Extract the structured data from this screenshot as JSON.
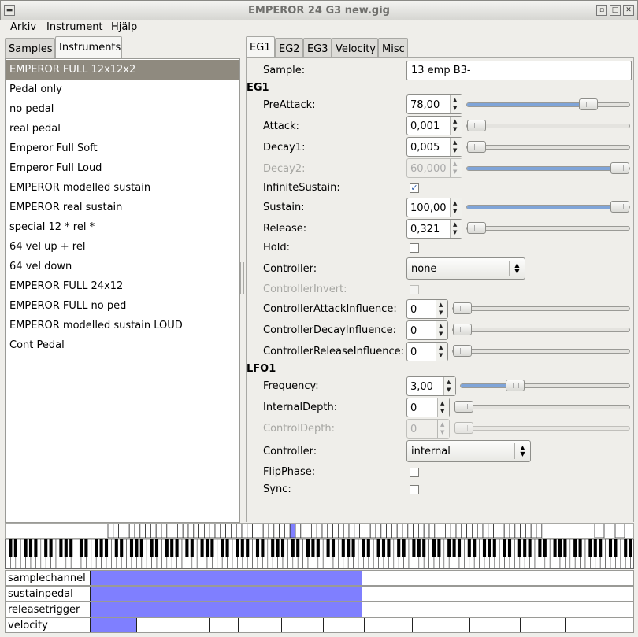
{
  "window": {
    "title": "EMPEROR 24 G3 new.gig"
  },
  "menu": [
    "Arkiv",
    "Instrument",
    "Hjälp"
  ],
  "left_tabs": [
    "Samples",
    "Instruments"
  ],
  "instruments": [
    "EMPEROR FULL 12x12x2",
    "Pedal only",
    "no pedal",
    "real pedal",
    "Emperor Full Soft",
    "Emperor Full Loud",
    "EMPEROR modelled sustain",
    "EMPEROR real sustain",
    "special 12  * rel *",
    "64 vel up + rel",
    "64 vel down",
    "EMPEROR FULL 24x12",
    "EMPEROR FULL no ped",
    "EMPEROR modelled sustain LOUD",
    "Cont Pedal"
  ],
  "selected_instrument": 0,
  "right_tabs": [
    "EG1",
    "EG2",
    "EG3",
    "Velocity",
    "Misc"
  ],
  "sample": {
    "label": "Sample:",
    "value": "13 emp B3-"
  },
  "eg1": {
    "section": "EG1",
    "preattack": {
      "label": "PreAttack:",
      "value": "78,00",
      "level": 0.78
    },
    "attack": {
      "label": "Attack:",
      "value": "0,001",
      "level": 0.0
    },
    "decay1": {
      "label": "Decay1:",
      "value": "0,005",
      "level": 0.0
    },
    "decay2": {
      "label": "Decay2:",
      "value": "60,000",
      "level": 1.0
    },
    "infinite_sustain": {
      "label": "InfiniteSustain:",
      "checked": true
    },
    "sustain": {
      "label": "Sustain:",
      "value": "100,00",
      "level": 1.0
    },
    "release": {
      "label": "Release:",
      "value": "0,321",
      "level": 0.0
    },
    "hold": {
      "label": "Hold:",
      "checked": false
    },
    "controller": {
      "label": "Controller:",
      "value": "none"
    },
    "controller_invert": {
      "label": "ControllerInvert:",
      "checked": false
    },
    "attack_influence": {
      "label": "ControllerAttackInfluence:",
      "value": "0",
      "level": 0.0
    },
    "decay_influence": {
      "label": "ControllerDecayInfluence:",
      "value": "0",
      "level": 0.0
    },
    "release_influence": {
      "label": "ControllerReleaseInfluence:",
      "value": "0",
      "level": 0.0
    }
  },
  "lfo1": {
    "section": "LFO1",
    "frequency": {
      "label": "Frequency:",
      "value": "3,00",
      "level": 0.3
    },
    "internal_depth": {
      "label": "InternalDepth:",
      "value": "0",
      "level": 0.0
    },
    "control_depth": {
      "label": "ControlDepth:",
      "value": "0",
      "level": 0.0
    },
    "controller": {
      "label": "Controller:",
      "value": "internal"
    },
    "flip_phase": {
      "label": "FlipPhase:",
      "checked": false
    },
    "sync": {
      "label": "Sync:",
      "checked": false
    }
  },
  "dimensions": [
    {
      "name": "samplechannel",
      "filled": 0.5
    },
    {
      "name": "sustainpedal",
      "filled": 0.5
    },
    {
      "name": "releasetrigger",
      "filled": 0.5
    },
    {
      "name": "velocity",
      "zones": 12,
      "selected": 0
    }
  ],
  "colors": {
    "accent": "#7f7fff",
    "selection": "#8f8a7f",
    "slider_fill": "#7fa4d8"
  }
}
